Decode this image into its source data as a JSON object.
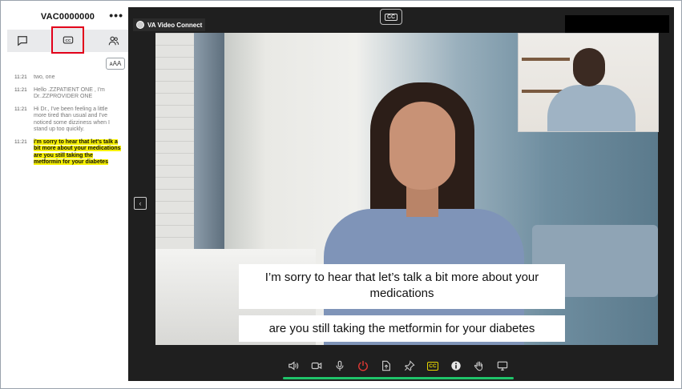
{
  "sidebar": {
    "title": "VAC0000000",
    "more_label": "•••",
    "tabs": [
      {
        "icon": "chat-icon",
        "active": false
      },
      {
        "icon": "closed-captions-icon",
        "active": true
      },
      {
        "icon": "participants-icon",
        "active": false
      }
    ],
    "text_size_label": "ᴀAA",
    "messages": [
      {
        "time": "11:21",
        "text": "two, one",
        "highlight": false
      },
      {
        "time": "11:21",
        "text": "Hello  .ZZPATIENT ONE      , I'm Dr..ZZPROVIDER ONE",
        "highlight": false
      },
      {
        "time": "11:21",
        "text": "Hi Dr., I've been feeling a little more tired than usual and I've noticed some dizziness when I stand up too quickly.",
        "highlight": false
      },
      {
        "time": "11:21",
        "text": "i'm sorry to hear that let's talk a bit more about your medications are you still taking the metformin for your diabetes",
        "highlight": true
      }
    ]
  },
  "video": {
    "app_name": "VA Video Connect",
    "cc_label": "CC",
    "collapse_icon": "‹",
    "captions": {
      "line1": "I’m sorry to hear that let’s talk a bit more about your medications",
      "line2": "are you still taking the metformin for your diabetes"
    }
  },
  "toolbar": {
    "cc_label": "CC",
    "buttons": [
      "speaker-icon",
      "camera-icon",
      "microphone-icon",
      "leave-icon",
      "share-file-icon",
      "pin-icon",
      "captions-icon",
      "info-icon",
      "raise-hand-icon",
      "screen-share-icon"
    ],
    "colors": {
      "leave": "#e53935",
      "captions": "#e6d600",
      "audio_level": "#1fc46a"
    }
  }
}
